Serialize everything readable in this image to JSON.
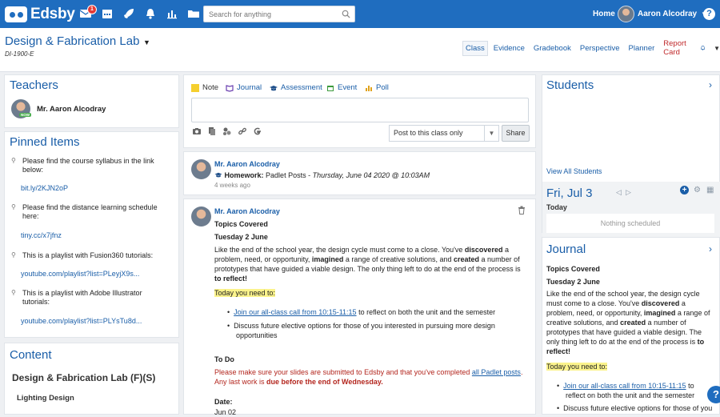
{
  "app": {
    "brand": "Edsby",
    "mail_badge": "1"
  },
  "topbar": {
    "search_placeholder": "Search for anything",
    "home_label": "Home",
    "user_name": "Aaron Alcodray",
    "help_label": "?"
  },
  "class": {
    "title": "Design & Fabrication Lab",
    "code": "DI-1900-E",
    "tabs": [
      {
        "label": "Class",
        "active": true
      },
      {
        "label": "Evidence"
      },
      {
        "label": "Gradebook"
      },
      {
        "label": "Perspective"
      },
      {
        "label": "Planner"
      },
      {
        "label": "Report Card"
      }
    ]
  },
  "teachers": {
    "title": "Teachers",
    "badge": "NOW",
    "name": "Mr. Aaron Alcodray"
  },
  "pinned": {
    "title": "Pinned Items",
    "items": [
      {
        "text": "Please find the course syllabus in the link below:",
        "link": "bit.ly/2KJN2oP"
      },
      {
        "text": "Please find the distance learning schedule here:",
        "link": "tiny.cc/x7jfnz"
      },
      {
        "text": "This is a playlist with Fusion360 tutorials:",
        "link": "youtube.com/playlist?list=PLeyjX9s..."
      },
      {
        "text": "This is a playlist with Adobe Illustrator tutorials:",
        "link": "youtube.com/playlist?list=PLYsTu8d..."
      }
    ]
  },
  "content": {
    "title": "Content",
    "course": "Design & Fabrication Lab (F)(S)",
    "item": "Lighting Design"
  },
  "composer": {
    "types": [
      "Note",
      "Journal",
      "Assessment",
      "Event",
      "Poll"
    ],
    "post_to": "Post to this class only",
    "share_label": "Share"
  },
  "post1": {
    "author": "Mr. Aaron Alcodray",
    "kind": "Homework:",
    "title": "Padlet Posts",
    "date": "Thursday, June 04 2020 @ 10:03AM",
    "ago": "4 weeks ago"
  },
  "post2": {
    "author": "Mr. Aaron Alcodray",
    "heading": "Topics Covered",
    "date": "Tuesday 2 June",
    "p_a": "Like the end of the school year, the design cycle must come to a close. You've ",
    "b1": "discovered",
    "p_b": " a problem, need, or opportunity, ",
    "b2": "imagined",
    "p_c": " a range of creative solutions, and ",
    "b3": "created",
    "p_d": " a number of prototypes that have guided a viable design. The only thing left to do at the end of the process is ",
    "b4": "to reflect!",
    "need": "Today you need to:",
    "bullet1_link": "Join our all-class call from 10:15-11:15",
    "bullet1_rest": " to reflect on both the unit and the semester",
    "bullet2": "Discuss future elective options for those of you interested in pursuing more design opportunities",
    "todo": "To Do",
    "red_a": "Please make sure your slides are submitted to Edsby and that you've completed ",
    "red_link": "all Padlet posts",
    "red_b": ".",
    "red_c": "Any last work is ",
    "red_bold": "due before the end of Wednesday.",
    "date_label": "Date:",
    "date_value": "Jun 02"
  },
  "students": {
    "title": "Students",
    "view_all": "View All Students"
  },
  "calendar": {
    "date": "Fri, Jul 3",
    "today": "Today",
    "empty": "Nothing scheduled"
  },
  "journal": {
    "title": "Journal",
    "heading": "Topics Covered",
    "date": "Tuesday 2 June",
    "p_a": "Like the end of the school year, the design cycle must come to a close. You've ",
    "b1": "discovered",
    "p_b": " a problem, need, or opportunity, ",
    "b2": "imagined",
    "p_c": " a range of creative solutions, and ",
    "b3": "created",
    "p_d": " a number of prototypes that have guided a viable design. The only thing left to do at the end of the process is ",
    "b4": "to reflect!",
    "need": "Today you need to:",
    "bullet1_link": "Join our all-class call from 10:15-11:15",
    "bullet1_rest": " to reflect on both the unit and the semester",
    "bullet2": "Discuss future elective options for those of you"
  }
}
